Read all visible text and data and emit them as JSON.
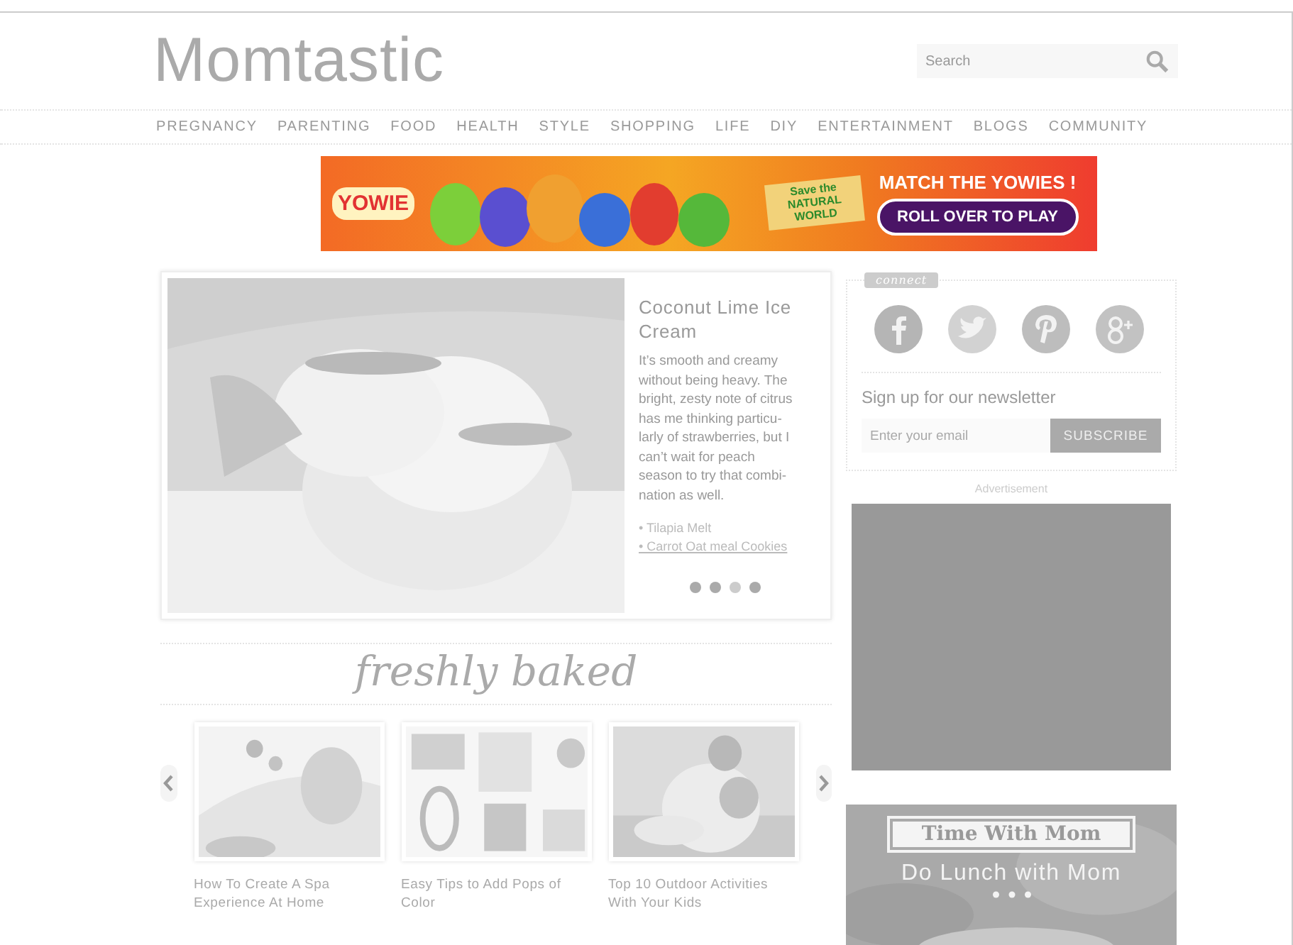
{
  "logo": "Momtastic",
  "search": {
    "placeholder": "Search"
  },
  "nav": [
    "PREGNANCY",
    "PARENTING",
    "FOOD",
    "HEALTH",
    "STYLE",
    "SHOPPING",
    "LIFE",
    "DIY",
    "ENTERTAINMENT",
    "BLOGS",
    "COMMUNITY"
  ],
  "banner": {
    "brand": "YOWIE",
    "sign": "Save the NATURAL WORLD",
    "headline": "MATCH THE YOWIES !",
    "button": "ROLL OVER TO PLAY"
  },
  "feature": {
    "title": "Coconut Lime Ice Cream",
    "body_lines": [
      "It’s smooth and creamy",
      "without being heavy. The",
      "bright, zesty note of citrus",
      "has me thinking particu-",
      "larly of strawberries, but I",
      "can’t wait for peach",
      "season to try that combi-",
      "nation as well."
    ],
    "links": [
      {
        "text": "• Tilapia Melt",
        "hovered": false
      },
      {
        "text": "• Carrot Oat meal Cookies",
        "hovered": true
      }
    ],
    "dots": [
      {
        "selected": false
      },
      {
        "selected": false
      },
      {
        "selected": true
      },
      {
        "selected": false
      }
    ]
  },
  "section_title": "freshly baked",
  "articles": [
    {
      "title": "How To Create A Spa Experience At Home"
    },
    {
      "title": "Easy Tips to Add Pops of Color"
    },
    {
      "title": "Top 10 Outdoor Activities With Your Kids"
    }
  ],
  "connect": {
    "label": "connect"
  },
  "newsletter": {
    "title": "Sign up for our newsletter",
    "placeholder": "Enter your email",
    "button": "SUBSCRIBE"
  },
  "ad_label": "Advertisement",
  "promo": {
    "ribbon": "Time With Mom",
    "title": "Do Lunch with Mom"
  }
}
